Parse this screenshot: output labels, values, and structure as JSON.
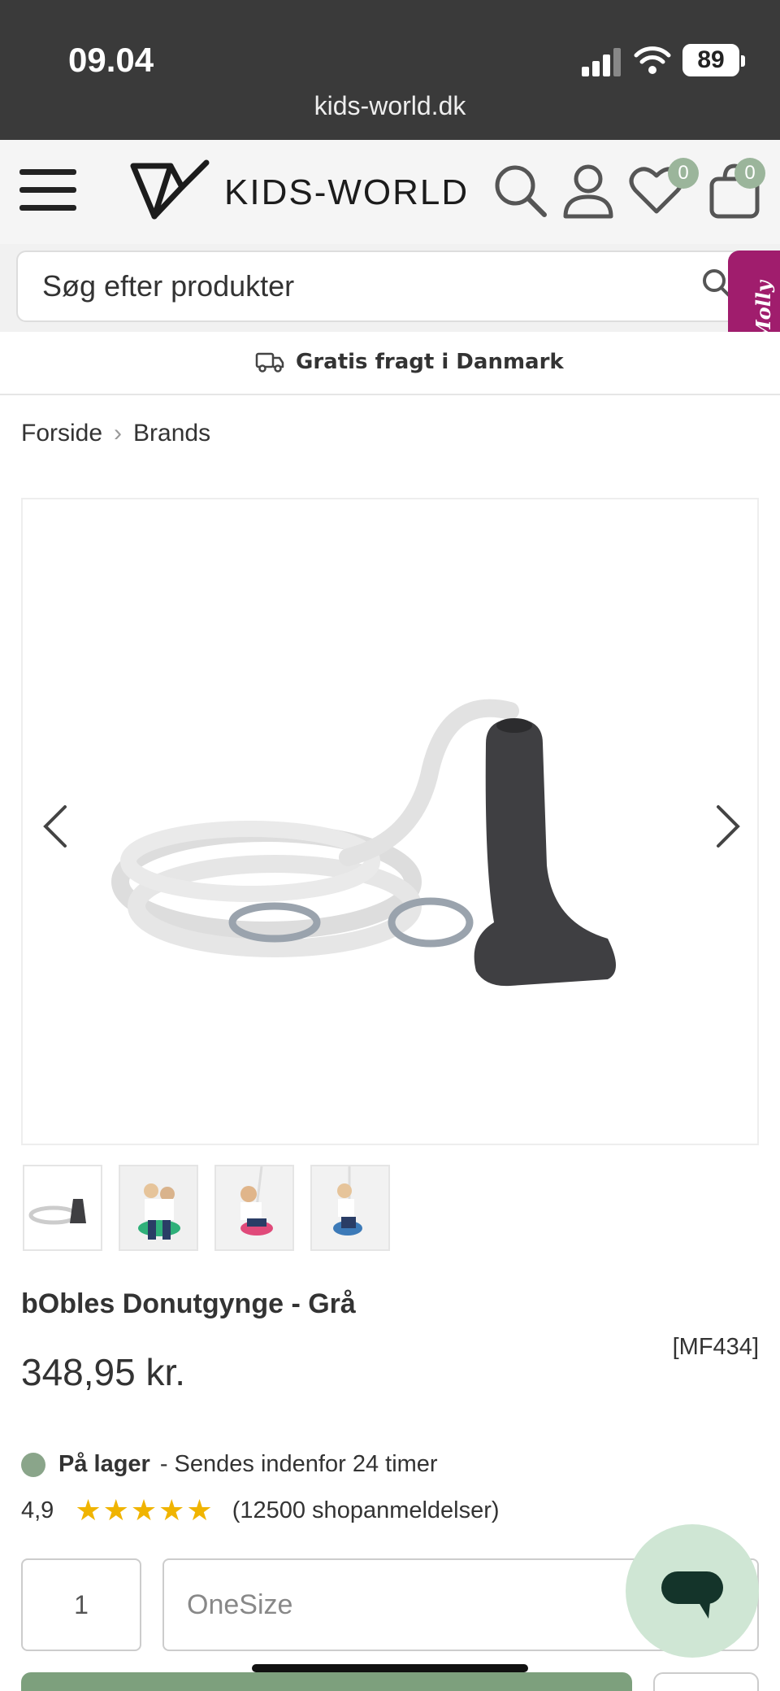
{
  "status_bar": {
    "time": "09.04",
    "url": "kids-world.dk",
    "battery": "89"
  },
  "header": {
    "logo_text": "KIDS-WORLD",
    "wishlist_count": "0",
    "cart_count": "0"
  },
  "search": {
    "placeholder": "Søg efter produkter"
  },
  "assistant": {
    "label": "Molly"
  },
  "shipping": {
    "text": "Gratis fragt i Danmark"
  },
  "breadcrumb": {
    "items": [
      "Forside",
      "Brands"
    ]
  },
  "product": {
    "title": "bObles Donutgynge - Grå",
    "sku": "[MF434]",
    "price": "348,95 kr.",
    "stock_label": "På lager",
    "stock_detail": "- Sendes indenfor 24 timer",
    "rating": "4,9",
    "stars": "★★★★★",
    "reviews": "(12500 shopanmeldelser)",
    "quantity": "1",
    "size": "OneSize"
  },
  "colors": {
    "accent": "#9bb59b",
    "stock_dot": "#8aa58a",
    "stars": "#f0b400",
    "molly": "#a01d6d",
    "statusbar": "#3a3a3a"
  }
}
